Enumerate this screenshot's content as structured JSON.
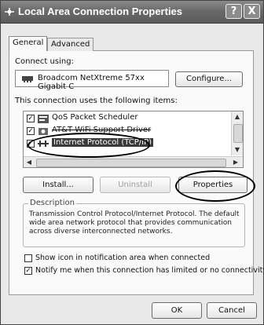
{
  "window": {
    "title": "Local Area Connection Properties",
    "help_label": "?",
    "close_label": "X"
  },
  "tabs": [
    {
      "label": "General",
      "active": true
    },
    {
      "label": "Advanced",
      "active": false
    }
  ],
  "connect_using": {
    "label": "Connect using:",
    "adapter": "Broadcom NetXtreme 57xx Gigabit C",
    "configure_label": "Configure..."
  },
  "components": {
    "label": "This connection uses the following items:",
    "items": [
      {
        "label": "QoS Packet Scheduler",
        "checked": true,
        "icon": "scheduler-icon"
      },
      {
        "label": "AT&T WiFi Support Driver",
        "checked": true,
        "icon": "driver-icon"
      },
      {
        "label": "Internet Protocol (TCP/IP)",
        "checked": true,
        "icon": "protocol-icon",
        "selected": true
      }
    ]
  },
  "buttons": {
    "install": "Install...",
    "uninstall": "Uninstall",
    "properties": "Properties",
    "ok": "OK",
    "cancel": "Cancel"
  },
  "description": {
    "legend": "Description",
    "text": "Transmission Control Protocol/Internet Protocol. The default wide area network protocol that provides communication across diverse interconnected networks."
  },
  "options": [
    {
      "label": "Show icon in notification area when connected",
      "checked": false
    },
    {
      "label": "Notify me when this connection has limited or no connectivity",
      "checked": true
    }
  ]
}
